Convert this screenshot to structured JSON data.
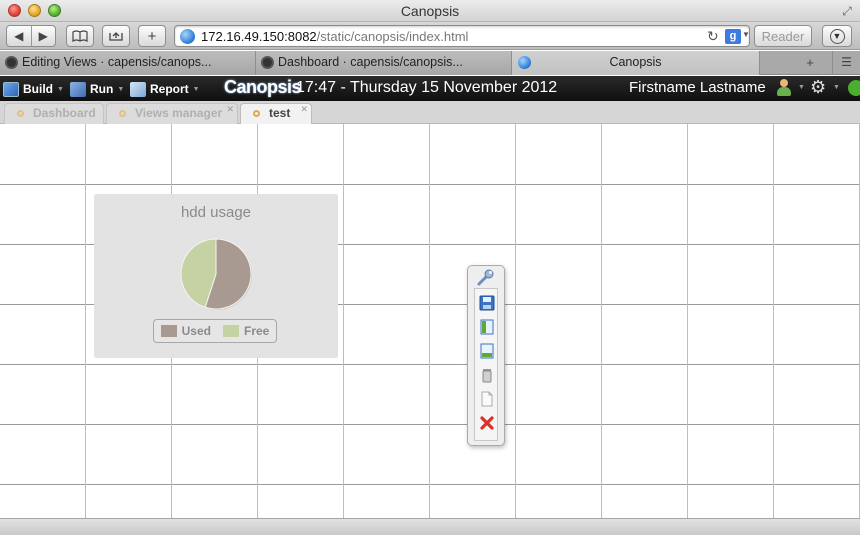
{
  "window": {
    "title": "Canopsis"
  },
  "toolbar": {
    "url_host": "172.16.49.150:8082",
    "url_path": "/static/canopsis/index.html",
    "reader_label": "Reader",
    "search_engine_letter": "g"
  },
  "browser_tabs": [
    {
      "label": "Editing Views · capensis/canops...",
      "favicon": "github-icon"
    },
    {
      "label": "Dashboard · capensis/canopsis...",
      "favicon": "github-icon"
    },
    {
      "label": "Canopsis",
      "favicon": "globe-icon",
      "active": true
    }
  ],
  "appbar": {
    "menus": [
      {
        "label": "Build",
        "icon": "build-icon"
      },
      {
        "label": "Run",
        "icon": "run-icon"
      },
      {
        "label": "Report",
        "icon": "report-icon"
      }
    ],
    "brand": "Canopsis",
    "clock": "17:47 - Thursday 15 November 2012",
    "username": "Firstname Lastname"
  },
  "app_tabs": [
    {
      "label": "Dashboard",
      "active": false
    },
    {
      "label": "Views manager",
      "active": false
    },
    {
      "label": "test",
      "active": true
    }
  ],
  "widget": {
    "title": "hdd usage",
    "chart_data": {
      "type": "pie",
      "title": "hdd usage",
      "categories": [
        "Used",
        "Free"
      ],
      "values": [
        55,
        45
      ],
      "colors": [
        "#a89a90",
        "#c5d2a4"
      ],
      "legend_position": "bottom"
    }
  },
  "palette": {
    "handle_icon": "wrench-icon",
    "tools": [
      "save-icon",
      "column-layout-icon",
      "row-layout-icon",
      "trash-icon",
      "document-icon",
      "close-icon"
    ]
  },
  "colors": {
    "appbar_bg": "#1a1a1a",
    "pie_used": "#a89a90",
    "pie_free": "#c5d2a4"
  }
}
